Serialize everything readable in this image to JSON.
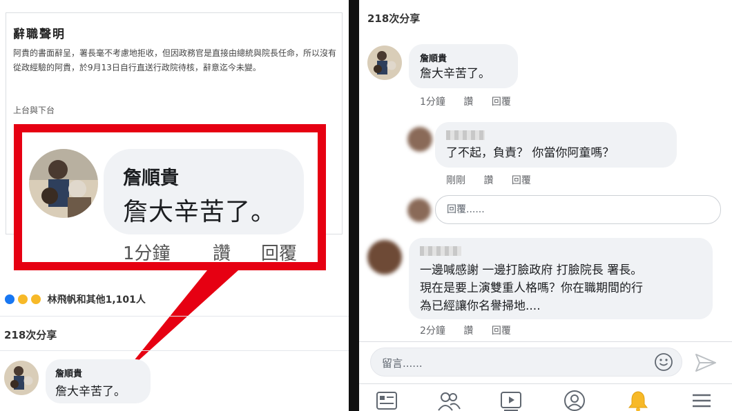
{
  "left": {
    "article": {
      "title": "辭職聲明",
      "body": "阿貴的書面辭呈，署長毫不考慮地拒收，但因政務官是直接由總統與院長任命，所以沒有從政經驗的阿貴，於9月13日自行直送行政院待核，辭意迄今未變。",
      "subheading": "上台與下台"
    },
    "highlight": {
      "name": "詹順貴",
      "text": "詹大辛苦了。",
      "time": "1分鐘",
      "like": "讚",
      "reply": "回覆"
    },
    "reactions": {
      "summary": "林飛帆和其他1,101人",
      "types": [
        "like-icon",
        "sad-icon",
        "wow-icon"
      ]
    },
    "shares": "218次分享",
    "comment": {
      "name": "詹順貴",
      "text": "詹大辛苦了。"
    }
  },
  "right": {
    "shares": "218次分享",
    "comments": [
      {
        "name": "詹順貴",
        "text": "詹大辛苦了。",
        "time": "1分鐘",
        "like": "讚",
        "reply": "回覆"
      },
      {
        "text": "了不起，負責？ 你當你阿童嗎？",
        "time": "剛剛",
        "like": "讚",
        "reply": "回覆"
      },
      {
        "text_lines": [
          "一邊喊感謝 一邊打臉政府 打臉院長 署長。",
          "現在是要上演雙重人格嗎？你在職期間的行",
          "為已經讓你名譽掃地...."
        ],
        "time": "2分鐘",
        "like": "讚",
        "reply": "回覆"
      }
    ],
    "reply_placeholder": "回覆......",
    "compose_placeholder": "留言......",
    "tabs": [
      "news-feed-icon",
      "friends-icon",
      "watch-icon",
      "profile-icon",
      "notifications-icon",
      "menu-icon"
    ]
  },
  "colors": {
    "highlight_border": "#e60012",
    "bubble": "#f0f2f5",
    "notification_bell": "#f7b928",
    "like_blue": "#1877f2"
  }
}
